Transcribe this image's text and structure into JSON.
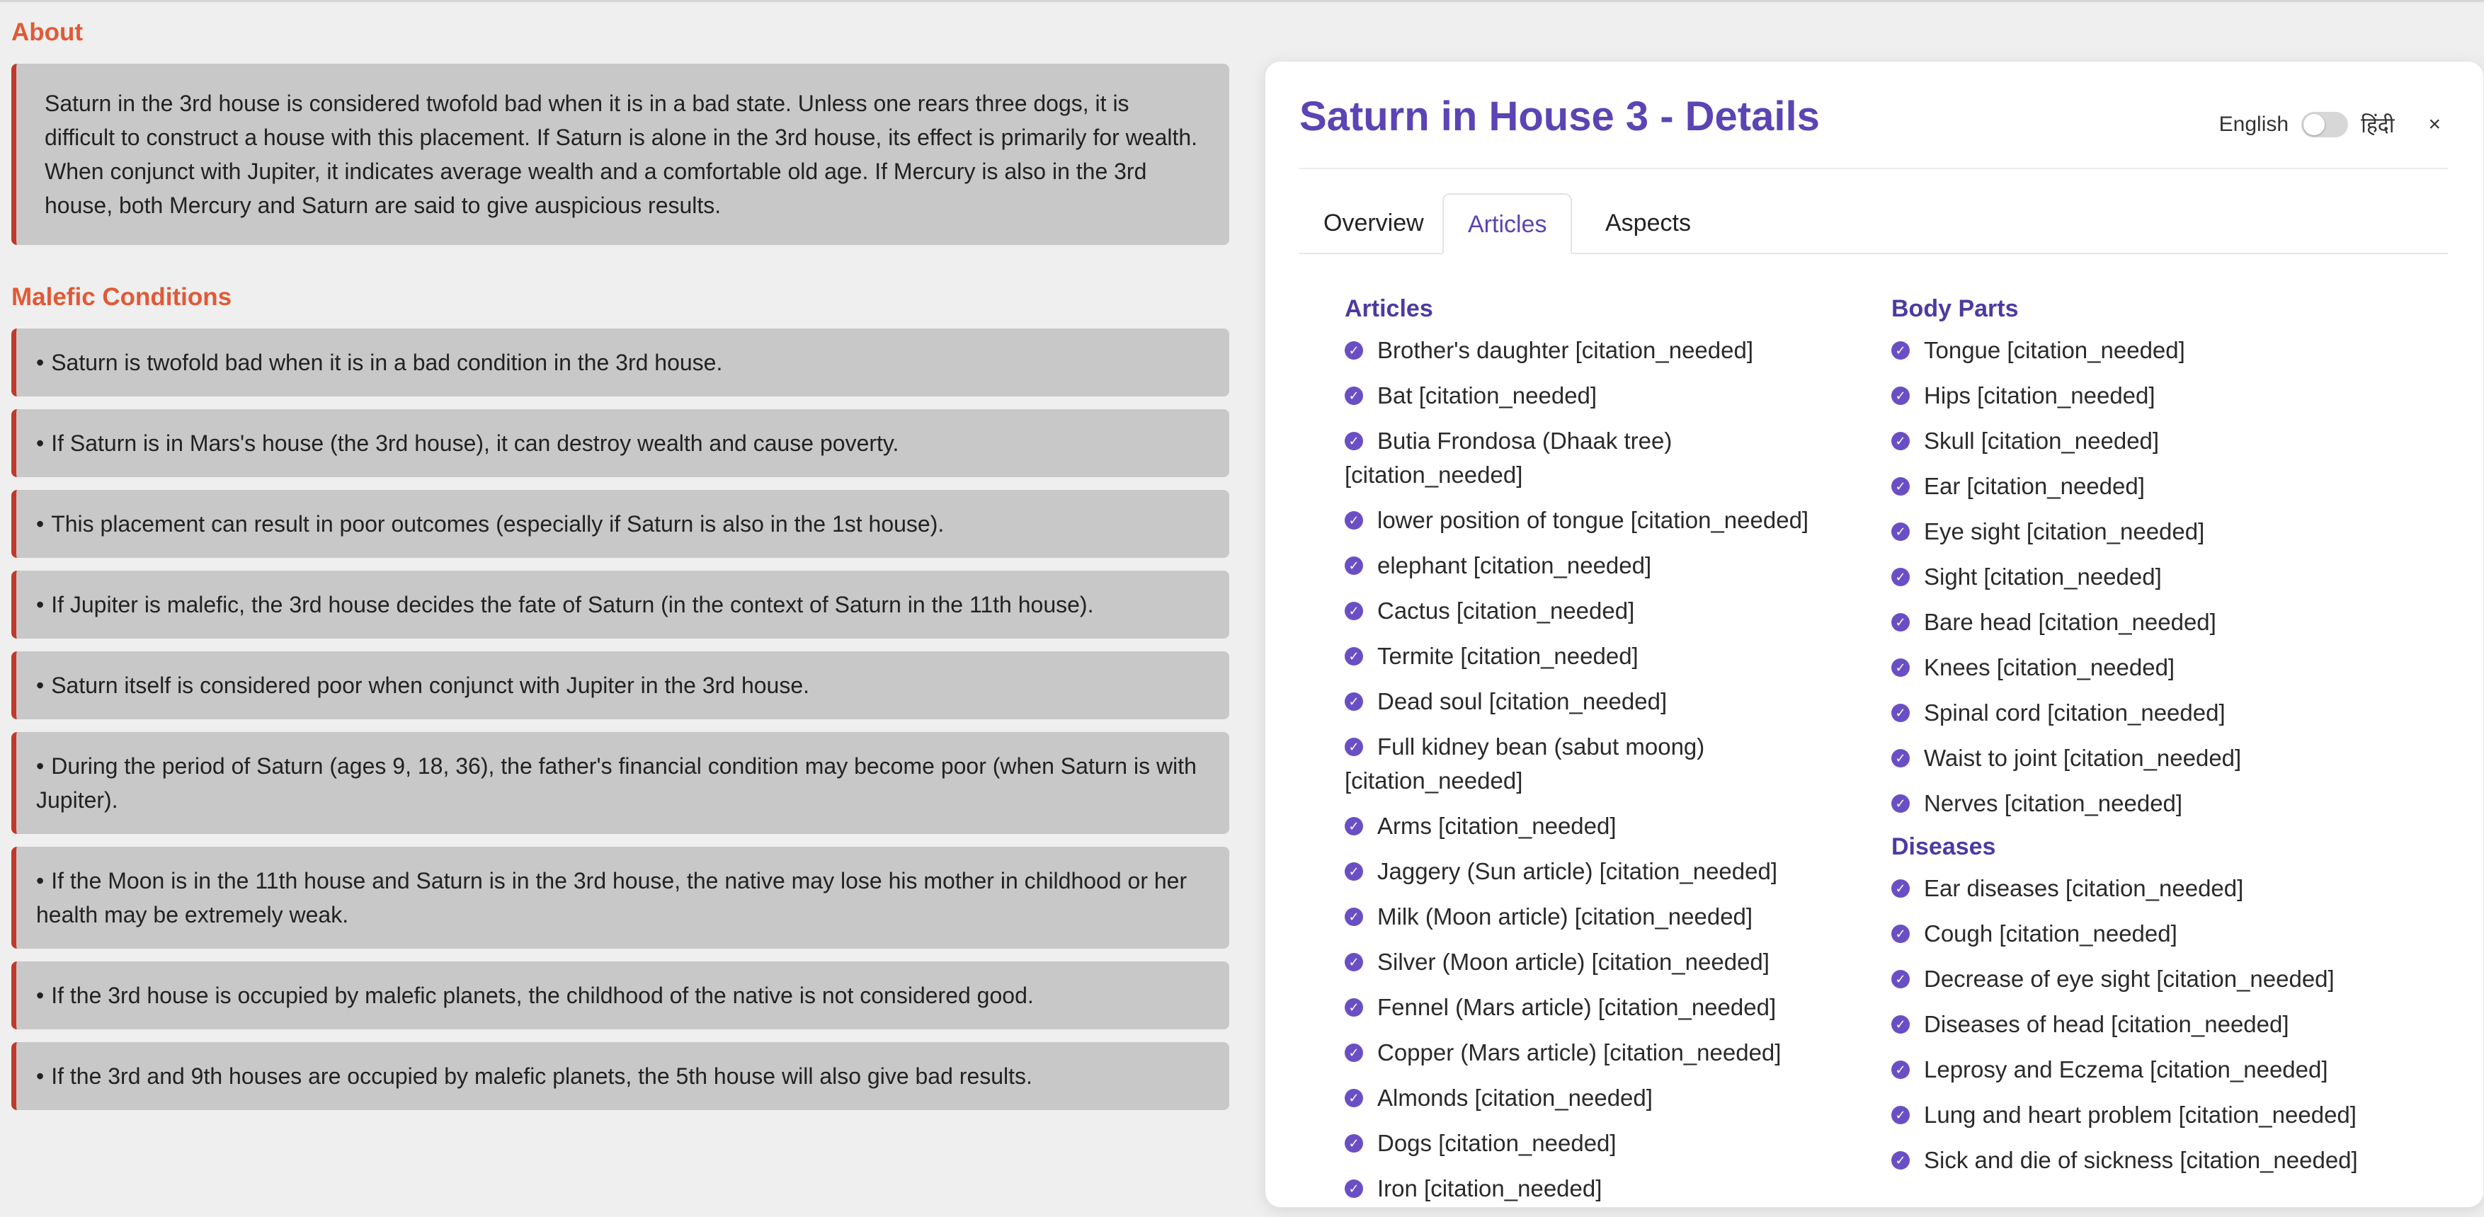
{
  "about": {
    "title": "About",
    "text": "Saturn in the 3rd house is considered twofold bad when it is in a bad state. Unless one rears three dogs, it is difficult to construct a house with this placement. If Saturn is alone in the 3rd house, its effect is primarily for wealth. When conjunct with Jupiter, it indicates average wealth and a comfortable old age. If Mercury is also in the 3rd house, both Mercury and Saturn are said to give auspicious results."
  },
  "malefic": {
    "title": "Malefic Conditions",
    "items": [
      "Saturn is twofold bad when it is in a bad condition in the 3rd house.",
      "If Saturn is in Mars's house (the 3rd house), it can destroy wealth and cause poverty.",
      "This placement can result in poor outcomes (especially if Saturn is also in the 1st house).",
      "If Jupiter is malefic, the 3rd house decides the fate of Saturn (in the context of Saturn in the 11th house).",
      "Saturn itself is considered poor when conjunct with Jupiter in the 3rd house.",
      "During the period of Saturn (ages 9, 18, 36), the father's financial condition may become poor (when Saturn is with Jupiter).",
      "If the Moon is in the 11th house and Saturn is in the 3rd house, the native may lose his mother in childhood or her health may be extremely weak.",
      "If the 3rd house is occupied by malefic planets, the childhood of the native is not considered good.",
      "If the 3rd and 9th houses are occupied by malefic planets, the 5th house will also give bad results."
    ]
  },
  "panel": {
    "title": "Saturn in House 3 - Details",
    "lang_left": "English",
    "lang_right": "हिंदी",
    "close": "×",
    "tabs": [
      "Overview",
      "Articles",
      "Aspects"
    ],
    "active_tab": "Articles",
    "articles": {
      "heading": "Articles",
      "items": [
        "Brother's daughter [citation_needed]",
        "Bat [citation_needed]",
        "Butia Frondosa (Dhaak tree) [citation_needed]",
        "lower position of tongue [citation_needed]",
        "elephant [citation_needed]",
        "Cactus [citation_needed]",
        "Termite [citation_needed]",
        "Dead soul [citation_needed]",
        "Full kidney bean (sabut moong) [citation_needed]",
        "Arms [citation_needed]",
        "Jaggery (Sun article) [citation_needed]",
        "Milk (Moon article) [citation_needed]",
        "Silver (Moon article) [citation_needed]",
        "Fennel (Mars article) [citation_needed]",
        "Copper (Mars article) [citation_needed]",
        "Almonds [citation_needed]",
        "Dogs [citation_needed]",
        "Iron [citation_needed]"
      ]
    },
    "body_parts": {
      "heading": "Body Parts",
      "items": [
        "Tongue [citation_needed]",
        "Hips [citation_needed]",
        "Skull [citation_needed]",
        "Ear [citation_needed]",
        "Eye sight [citation_needed]",
        "Sight [citation_needed]",
        "Bare head [citation_needed]",
        "Knees [citation_needed]",
        "Spinal cord [citation_needed]",
        "Waist to joint [citation_needed]",
        "Nerves [citation_needed]"
      ]
    },
    "diseases": {
      "heading": "Diseases",
      "items": [
        "Ear diseases [citation_needed]",
        "Cough [citation_needed]",
        "Decrease of eye sight [citation_needed]",
        "Diseases of head [citation_needed]",
        "Leprosy and Eczema [citation_needed]",
        "Lung and heart problem [citation_needed]",
        "Sick and die of sickness [citation_needed]"
      ]
    }
  },
  "colors": {
    "accent": "#e05a36",
    "border": "#c0392b",
    "purple": "#5b44b4"
  }
}
